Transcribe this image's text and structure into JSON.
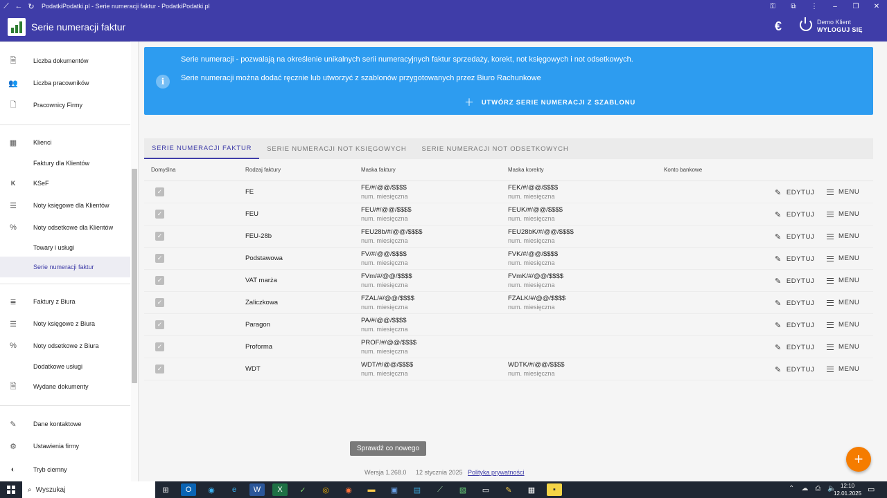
{
  "browser": {
    "tab_title": "PodatkiPodatki.pl - Serie numeracji faktur - PodatkiPodatki.pl"
  },
  "header": {
    "title": "Serie numeracji faktur",
    "currency_symbol": "€",
    "user_name": "Demo Klient",
    "logout_label": "WYLOGUJ SIĘ"
  },
  "sidebar": {
    "items": [
      {
        "label": "Liczba dokumentów",
        "icon": "document-icon"
      },
      {
        "label": "Liczba pracowników",
        "icon": "people-icon"
      },
      {
        "label": "Pracownicy Firmy",
        "icon": "person-doc-icon"
      },
      {
        "label": "Klienci",
        "icon": "building-icon"
      },
      {
        "label": "Faktury dla Klientów",
        "icon": ""
      },
      {
        "label": "KSeF",
        "icon": "ksef-icon"
      },
      {
        "label": "Noty księgowe dla Klientów",
        "icon": "note-icon"
      },
      {
        "label": "Noty odsetkowe dla Klientów",
        "icon": "percent-doc-icon"
      },
      {
        "label": "Towary i usługi",
        "icon": ""
      },
      {
        "label": "Serie numeracji faktur",
        "icon": ""
      },
      {
        "label": "Faktury z Biura",
        "icon": "list-icon"
      },
      {
        "label": "Noty księgowe z Biura",
        "icon": "note-icon"
      },
      {
        "label": "Noty odsetkowe z Biura",
        "icon": "percent-doc-icon"
      },
      {
        "label": "Dodatkowe usługi",
        "icon": ""
      },
      {
        "label": "Wydane dokumenty",
        "icon": "issued-doc-icon"
      },
      {
        "label": "Dane kontaktowe",
        "icon": "contact-icon"
      },
      {
        "label": "Ustawienia firmy",
        "icon": "gear-icon"
      },
      {
        "label": "Tryb ciemny",
        "icon": "dark-mode-icon"
      }
    ]
  },
  "info": {
    "line1": "Serie numeracji - pozwalają na określenie unikalnych serii numeracyjnych faktur sprzedaży, korekt, not księgowych i not odsetkowych.",
    "line2": "Serie numeracji można dodać ręcznie lub utworzyć z szablonów przygotowanych przez Biuro Rachunkowe",
    "create_label": "UTWÓRZ SERIE NUMERACJI Z SZABLONU"
  },
  "tabs": [
    {
      "label": "SERIE NUMERACJI FAKTUR",
      "active": true
    },
    {
      "label": "SERIE NUMERACJI NOT KSIĘGOWYCH",
      "active": false
    },
    {
      "label": "SERIE NUMERACJI NOT ODSETKOWYCH",
      "active": false
    }
  ],
  "table": {
    "headers": {
      "default": "Domyślna",
      "type": "Rodzaj faktury",
      "mask": "Maska faktury",
      "correction_mask": "Maska korekty",
      "bank": "Konto bankowe"
    },
    "edit_label": "EDYTUJ",
    "menu_label": "MENU",
    "rows": [
      {
        "type": "FE",
        "mask": "FE/#/@@/$$$$",
        "mask_sub": "num. miesięczna",
        "corr": "FEK/#/@@/$$$$",
        "corr_sub": "num. miesięczna"
      },
      {
        "type": "FEU",
        "mask": "FEU/#/@@/$$$$",
        "mask_sub": "num. miesięczna",
        "corr": "FEUK/#/@@/$$$$",
        "corr_sub": "num. miesięczna"
      },
      {
        "type": "FEU-28b",
        "mask": "FEU28b/#/@@/$$$$",
        "mask_sub": "num. miesięczna",
        "corr": "FEU28bK/#/@@/$$$$",
        "corr_sub": "num. miesięczna"
      },
      {
        "type": "Podstawowa",
        "mask": "FV/#/@@/$$$$",
        "mask_sub": "num. miesięczna",
        "corr": "FVK/#/@@/$$$$",
        "corr_sub": "num. miesięczna"
      },
      {
        "type": "VAT marża",
        "mask": "FVm/#/@@/$$$$",
        "mask_sub": "num. miesięczna",
        "corr": "FVmK/#/@@/$$$$",
        "corr_sub": "num. miesięczna"
      },
      {
        "type": "Zaliczkowa",
        "mask": "FZAL/#/@@/$$$$",
        "mask_sub": "num. miesięczna",
        "corr": "FZALK/#/@@/$$$$",
        "corr_sub": "num. miesięczna"
      },
      {
        "type": "Paragon",
        "mask": "PA/#/@@/$$$$",
        "mask_sub": "num. miesięczna",
        "corr": "",
        "corr_sub": ""
      },
      {
        "type": "Proforma",
        "mask": "PROF/#/@@/$$$$",
        "mask_sub": "num. miesięczna",
        "corr": "",
        "corr_sub": ""
      },
      {
        "type": "WDT",
        "mask": "WDT/#/@@/$$$$",
        "mask_sub": "num. miesięczna",
        "corr": "WDTK/#/@@/$$$$",
        "corr_sub": "num. miesięczna"
      }
    ]
  },
  "toast": "Sprawdź co nowego",
  "footer": {
    "version": "Wersja 1.268.0",
    "date": "12 stycznia 2025",
    "privacy": "Polityka prywatności"
  },
  "taskbar": {
    "search_placeholder": "Wyszukaj",
    "time": "12:10",
    "date": "12.01.2025"
  },
  "colors": {
    "primary": "#3f3da8",
    "info": "#2d9cf0",
    "fab": "#f57c00"
  }
}
